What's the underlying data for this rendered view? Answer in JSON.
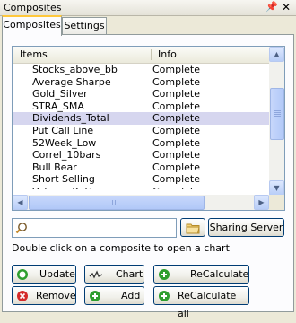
{
  "window": {
    "title": "Composites"
  },
  "tabs": [
    {
      "label": "Composites"
    },
    {
      "label": "Settings"
    }
  ],
  "list": {
    "columns": [
      "Items",
      "Info"
    ],
    "rows": [
      {
        "item": "Stocks_above_bb",
        "info": "Complete"
      },
      {
        "item": "Average Sharpe",
        "info": "Complete"
      },
      {
        "item": "Gold_Silver",
        "info": "Complete"
      },
      {
        "item": "STRA_SMA",
        "info": "Complete"
      },
      {
        "item": "Dividends_Total",
        "info": "Complete",
        "selected": true
      },
      {
        "item": "Put Call Line",
        "info": "Complete"
      },
      {
        "item": "52Week_Low",
        "info": "Complete"
      },
      {
        "item": "Correl_10bars",
        "info": "Complete"
      },
      {
        "item": "Bull Bear",
        "info": "Complete"
      },
      {
        "item": "Short Selling",
        "info": "Complete"
      },
      {
        "item": "Volume Ratio",
        "info": "Complete"
      }
    ]
  },
  "search": {
    "value": "",
    "placeholder": ""
  },
  "buttons": {
    "sharing_server": "Sharing Server",
    "update": "Update",
    "chart": "Chart",
    "recalculate": "ReCalculate",
    "remove": "Remove",
    "add": "Add",
    "recalculate_all": "ReCalculate all"
  },
  "hint": "Double click on a composite to open a chart",
  "colors": {
    "green": "#2e9e2e",
    "red": "#d42a2a",
    "selection": "#d6d6ef"
  },
  "icons": {
    "pin": "pin-icon",
    "close": "close-icon",
    "search": "magnifier-icon",
    "folder": "folder-icon",
    "update": "green-circle-icon",
    "remove": "red-circle-icon",
    "chart": "line-chart-icon",
    "add": "green-plus-icon",
    "recalculate": "green-plus-icon",
    "recalculate_all": "green-plus-icon"
  }
}
